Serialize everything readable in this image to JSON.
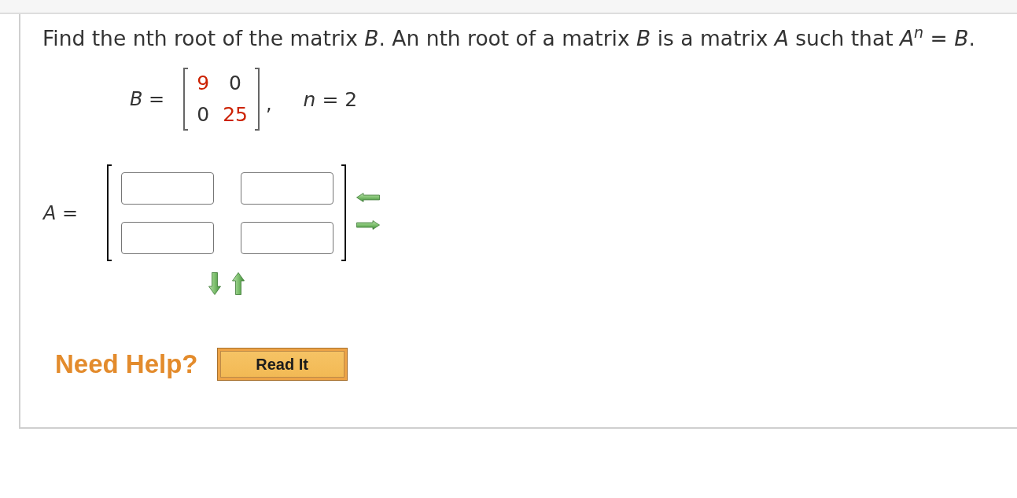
{
  "question": {
    "text": "Find the nth root of the matrix *B*. An nth root of a matrix *B* is a matrix *A* such that *A*$^{n}$ = *B*."
  },
  "given": {
    "label": "*B* =",
    "matrix": [
      [
        {
          "value": "9",
          "color": "#cc2200"
        },
        {
          "value": "0",
          "color": "#333333"
        }
      ],
      [
        {
          "value": "0",
          "color": "#333333"
        },
        {
          "value": "25",
          "color": "#cc2200"
        }
      ]
    ],
    "separator": ",",
    "parameter": "*n* = 2"
  },
  "answer": {
    "label": "*A* =",
    "rows": [
      [
        {
          "kind": "input"
        },
        {
          "kind": "input"
        }
      ],
      [
        {
          "kind": "input"
        },
        {
          "kind": "input"
        }
      ]
    ]
  },
  "help": {
    "label": "Need Help?",
    "buttons": [
      "Read It"
    ]
  }
}
